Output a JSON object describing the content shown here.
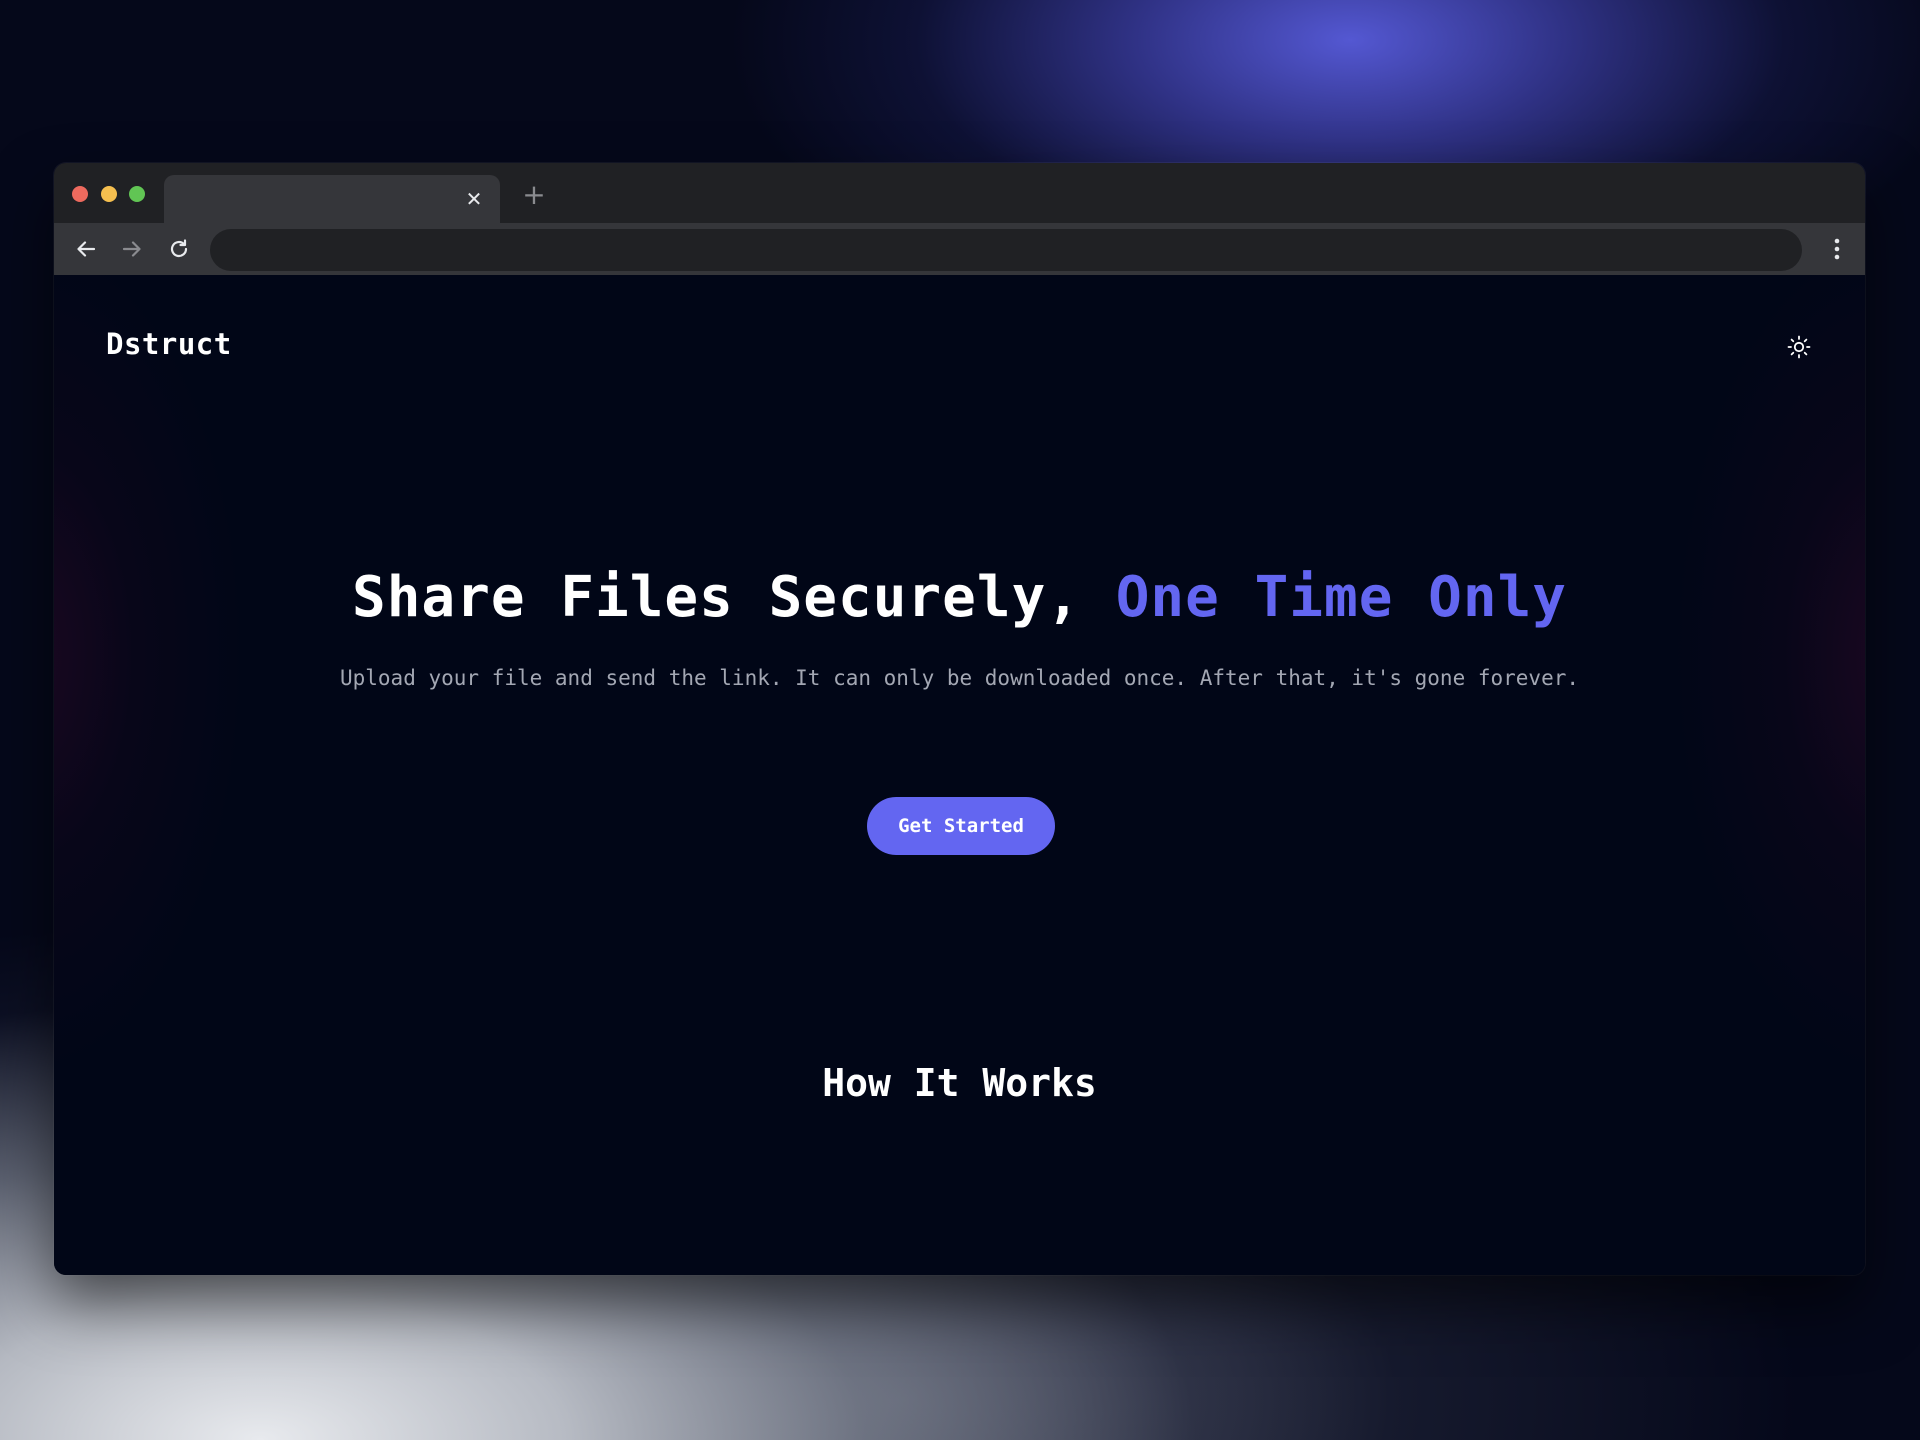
{
  "browser": {
    "tab_close_glyph": "✕",
    "new_tab_glyph": "+"
  },
  "header": {
    "logo": "Dstruct",
    "theme_toggle_icon": "sun-icon"
  },
  "hero": {
    "title_main": "Share Files Securely, ",
    "title_accent": "One Time Only",
    "subtitle": "Upload your file and send the link. It can only be downloaded once. After that, it's gone forever.",
    "cta_label": "Get Started"
  },
  "how_it_works": {
    "title": "How It Works"
  },
  "colors": {
    "accent": "#6366f1",
    "page_bg": "#010617",
    "subtitle_text": "#a3a7b3"
  }
}
